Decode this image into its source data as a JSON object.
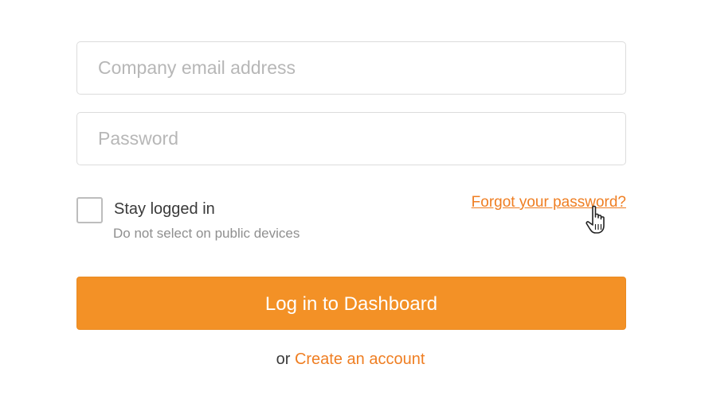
{
  "login_form": {
    "email": {
      "value": "",
      "placeholder": "Company email address"
    },
    "password": {
      "value": "",
      "placeholder": "Password"
    },
    "stay_logged_in": {
      "label": "Stay logged in",
      "hint": "Do not select on public devices",
      "checked": false
    },
    "forgot_password_link": "Forgot your password?",
    "submit_label": "Log in to Dashboard",
    "footer": {
      "prefix": "or",
      "create_account_link": "Create an account"
    }
  },
  "colors": {
    "accent": "#f39126",
    "link": "#ef7e22",
    "border": "#dcdcdc",
    "placeholder": "#b7b7b7"
  },
  "icons": {
    "cursor": "hand-pointer-icon"
  }
}
